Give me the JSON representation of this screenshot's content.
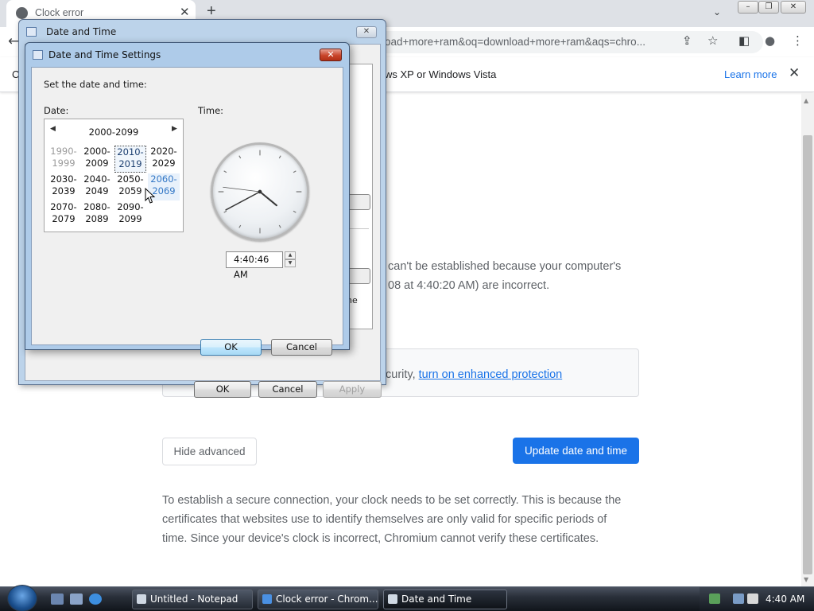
{
  "browser": {
    "tab_title": "Clock error",
    "tab_close": "✕",
    "new_tab": "+",
    "tab_search": "⌄",
    "url_visible": "oad+more+ram&oq=download+more+ram&aqs=chro...",
    "back_glyph": "←",
    "share_glyph": "⇪",
    "star_glyph": "☆",
    "sidepanel_glyph": "◧",
    "profile_glyph": "●",
    "menu_glyph": "⋮",
    "window_controls": [
      "–",
      "❐",
      "✕"
    ]
  },
  "infobar": {
    "left_fragment": "C",
    "text": "ws XP or Windows Vista",
    "learn_more": "Learn more",
    "close": "✕"
  },
  "page": {
    "error_line1": "can't be established because your computer's",
    "error_line2": "08 at 4:40:20 AM) are incorrect.",
    "protect_text": "curity, ",
    "protect_link": "turn on enhanced protection",
    "hide_advanced": "Hide advanced",
    "update_button": "Update date and time",
    "para_line1": "To establish a secure connection, your clock needs to be set correctly. This is because the",
    "para_line2": "certificates that websites use to identify themselves are only valid for specific periods of",
    "para_line3": "time. Since your device's clock is incorrect, Chromium cannot verify these certificates.",
    "behind_fragment": "ne"
  },
  "outer_dialog": {
    "title": "Date and Time",
    "close": "✕",
    "ok": "OK",
    "cancel": "Cancel",
    "apply": "Apply"
  },
  "inner_dialog": {
    "title": "Date and Time Settings",
    "close": "✕",
    "instruction": "Set the date and time:",
    "date_label": "Date:",
    "time_label": "Time:",
    "calendar": {
      "header": "2000-2099",
      "prev": "◀",
      "next": "▶",
      "decades": [
        {
          "top": "1990-",
          "bottom": "1999",
          "state": "dim"
        },
        {
          "top": "2000-",
          "bottom": "2009",
          "state": "normal"
        },
        {
          "top": "2010-",
          "bottom": "2019",
          "state": "selected"
        },
        {
          "top": "2020-",
          "bottom": "2029",
          "state": "normal"
        },
        {
          "top": "2030-",
          "bottom": "2039",
          "state": "normal"
        },
        {
          "top": "2040-",
          "bottom": "2049",
          "state": "normal"
        },
        {
          "top": "2050-",
          "bottom": "2059",
          "state": "normal"
        },
        {
          "top": "2060-",
          "bottom": "2069",
          "state": "hover"
        },
        {
          "top": "2070-",
          "bottom": "2079",
          "state": "normal"
        },
        {
          "top": "2080-",
          "bottom": "2089",
          "state": "normal"
        },
        {
          "top": "2090-",
          "bottom": "2099",
          "state": "normal"
        }
      ]
    },
    "time_value": "4:40:46 AM",
    "ok": "OK",
    "cancel": "Cancel"
  },
  "taskbar": {
    "buttons": [
      {
        "label": "Untitled - Notepad",
        "active": false
      },
      {
        "label": "Clock error - Chrom...",
        "active": false
      },
      {
        "label": "Date and Time",
        "active": true
      }
    ],
    "clock": "4:40 AM"
  }
}
